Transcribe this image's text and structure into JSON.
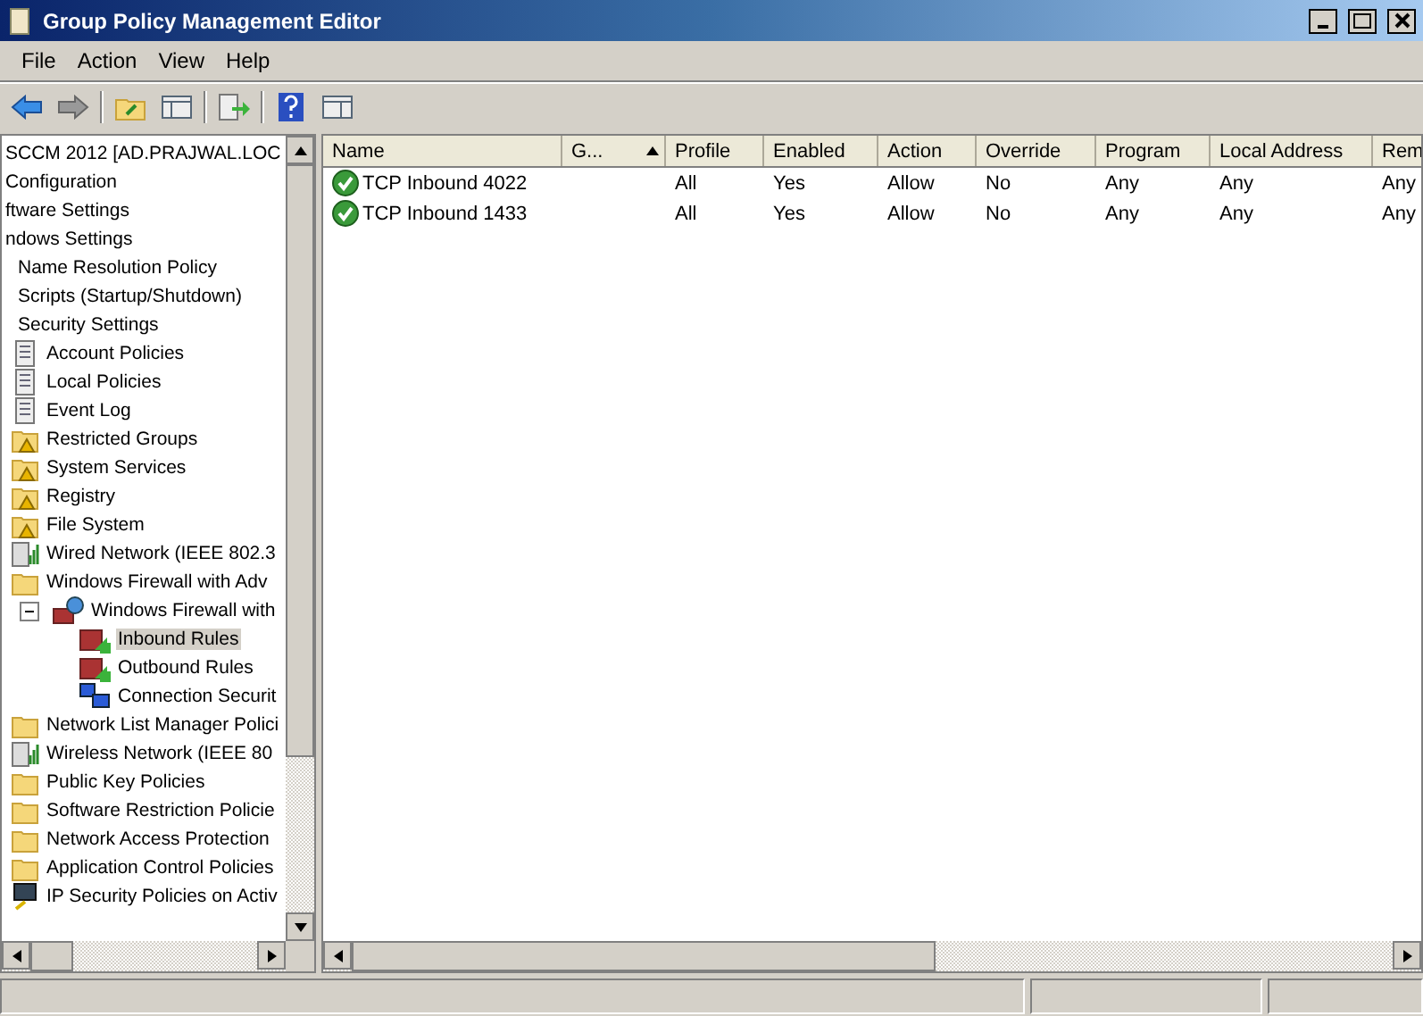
{
  "window": {
    "title": "Group Policy Management Editor"
  },
  "menu": [
    "File",
    "Action",
    "View",
    "Help"
  ],
  "tree": [
    {
      "label": "SCCM 2012 [AD.PRAJWAL.LOC",
      "selected": false
    },
    {
      "label": "Configuration",
      "selected": false
    },
    {
      "label": "ftware Settings",
      "selected": false
    },
    {
      "label": "ndows Settings",
      "selected": false,
      "children": [
        {
          "label": "Name Resolution Policy",
          "selected": false
        },
        {
          "label": "Scripts (Startup/Shutdown)",
          "selected": false
        },
        {
          "label": "Security Settings",
          "selected": false,
          "children": [
            {
              "label": "Account Policies",
              "kind": "doc",
              "selected": false
            },
            {
              "label": "Local Policies",
              "kind": "doc",
              "selected": false
            },
            {
              "label": "Event Log",
              "kind": "doc",
              "selected": false
            },
            {
              "label": "Restricted Groups",
              "kind": "lockfolder",
              "selected": false
            },
            {
              "label": "System Services",
              "kind": "lockfolder",
              "selected": false
            },
            {
              "label": "Registry",
              "kind": "lockfolder",
              "selected": false
            },
            {
              "label": "File System",
              "kind": "lockfolder",
              "selected": false
            },
            {
              "label": "Wired Network (IEEE 802.3",
              "kind": "network",
              "selected": false
            },
            {
              "label": "Windows Firewall with Adv",
              "kind": "folder",
              "selected": false,
              "children": [
                {
                  "label": "Windows Firewall with",
                  "kind": "firewall",
                  "selected": false,
                  "expanded": true,
                  "children": [
                    {
                      "label": "Inbound Rules",
                      "kind": "rules",
                      "selected": true
                    },
                    {
                      "label": "Outbound Rules",
                      "kind": "rules",
                      "selected": false
                    },
                    {
                      "label": "Connection Securit",
                      "kind": "connection",
                      "selected": false
                    }
                  ]
                }
              ]
            },
            {
              "label": "Network List Manager Polici",
              "kind": "folder",
              "selected": false
            },
            {
              "label": "Wireless Network (IEEE 80",
              "kind": "network",
              "selected": false
            },
            {
              "label": "Public Key Policies",
              "kind": "folder",
              "selected": false
            },
            {
              "label": "Software Restriction Policie",
              "kind": "folder",
              "selected": false
            },
            {
              "label": "Network Access Protection",
              "kind": "folder",
              "selected": false
            },
            {
              "label": "Application Control Policies",
              "kind": "folder",
              "selected": false
            },
            {
              "label": "IP Security Policies on Activ",
              "kind": "ip",
              "selected": false
            }
          ]
        }
      ]
    }
  ],
  "table": {
    "columns": [
      "Name",
      "G...",
      "Profile",
      "Enabled",
      "Action",
      "Override",
      "Program",
      "Local Address",
      "Rem"
    ],
    "rows": [
      [
        "TCP Inbound 4022",
        "",
        "All",
        "Yes",
        "Allow",
        "No",
        "Any",
        "Any",
        "Any"
      ],
      [
        "TCP Inbound 1433",
        "",
        "All",
        "Yes",
        "Allow",
        "No",
        "Any",
        "Any",
        "Any"
      ]
    ]
  }
}
